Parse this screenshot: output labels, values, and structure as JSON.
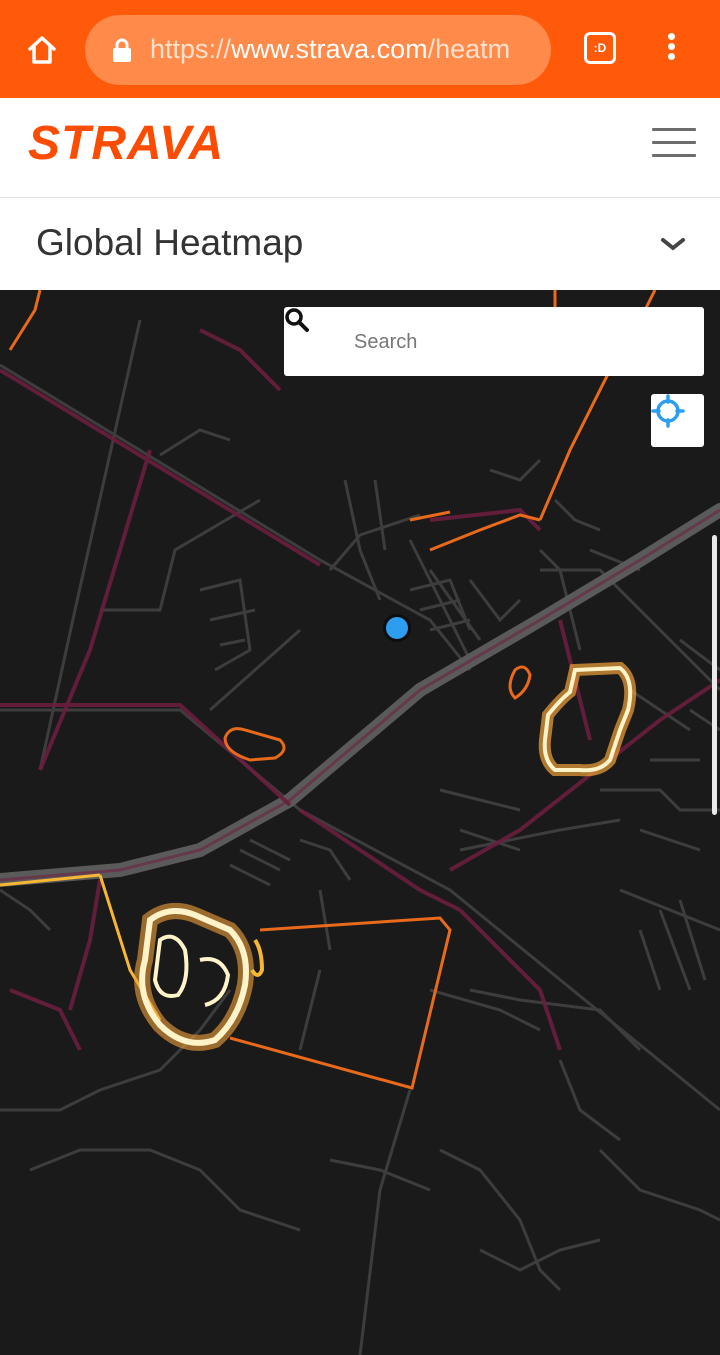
{
  "browser": {
    "url_scheme": "https://",
    "url_host": "www.strava.com",
    "url_path": "/heatm",
    "tabs_icon_label": ":D",
    "icons": [
      "home-icon",
      "lock-icon",
      "tabs-icon",
      "more-vert-icon"
    ]
  },
  "site": {
    "logo_text": "STRAVA",
    "brand_color": "#fc4c02",
    "menu_icon": "hamburger-menu-icon"
  },
  "page": {
    "title": "Global Heatmap",
    "dropdown_icon": "chevron-down-icon"
  },
  "map": {
    "search_placeholder": "Search",
    "search_icon": "search-icon",
    "locate_icon": "crosshair-locate-icon",
    "heat_colors": {
      "low": "#5a1a3a",
      "mid": "#e86a1a",
      "high": "#fff3c9"
    },
    "location_dot_color": "#2d9df0"
  }
}
